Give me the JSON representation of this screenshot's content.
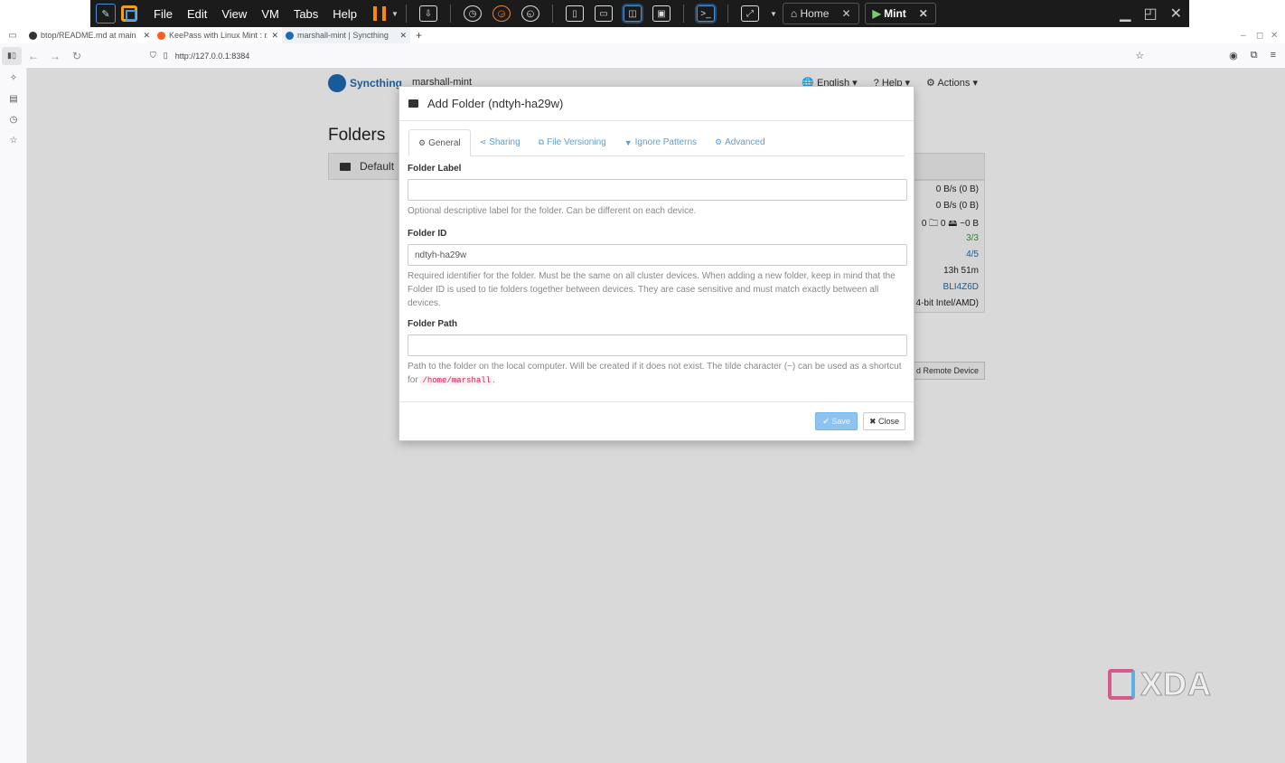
{
  "vm_toolbar": {
    "menu": [
      "File",
      "Edit",
      "View",
      "VM",
      "Tabs",
      "Help"
    ],
    "tabs": [
      {
        "label": "Home",
        "active": false
      },
      {
        "label": "Mint",
        "active": true
      }
    ]
  },
  "browser": {
    "tabs": [
      {
        "title": "btop/README.md at main",
        "active": false
      },
      {
        "title": "KeePass with Linux Mint : r/",
        "active": false
      },
      {
        "title": "marshall-mint | Syncthing",
        "active": true
      }
    ],
    "url": "http://127.0.0.1:8384"
  },
  "syncthing": {
    "brand": "Syncthing",
    "hostname": "marshall-mint",
    "nav": {
      "language": "English",
      "help": "Help",
      "actions": "Actions"
    },
    "folders_heading": "Folders",
    "default_folder": "Default",
    "device_stats": [
      {
        "text": "0 B/s (0 B)",
        "style": "normal"
      },
      {
        "text": "0 B/s (0 B)",
        "style": "normal"
      },
      {
        "text": "0   🗀 0   🖴 ~0 B",
        "style": "normal"
      },
      {
        "text": "3/3",
        "style": "green"
      },
      {
        "text": "4/5",
        "style": "blue"
      },
      {
        "text": "13h 51m",
        "style": "normal"
      },
      {
        "text": "BLI4Z6D",
        "style": "blue"
      },
      {
        "text": "4-bit Intel/AMD)",
        "style": "normal"
      }
    ],
    "add_remote_device": "d Remote Device"
  },
  "modal": {
    "title": "Add Folder (ndtyh-ha29w)",
    "tabs": [
      {
        "label": "General",
        "icon": "gear-icon",
        "glyph": "⚙",
        "active": true
      },
      {
        "label": "Sharing",
        "icon": "share-icon",
        "glyph": "⋖",
        "active": false
      },
      {
        "label": "File Versioning",
        "icon": "copy-icon",
        "glyph": "⧉",
        "active": false
      },
      {
        "label": "Ignore Patterns",
        "icon": "filter-icon",
        "glyph": "▼",
        "active": false
      },
      {
        "label": "Advanced",
        "icon": "cogs-icon",
        "glyph": "⚙",
        "active": false
      }
    ],
    "folder_label": {
      "label": "Folder Label",
      "value": "",
      "placeholder": "",
      "help": "Optional descriptive label for the folder. Can be different on each device."
    },
    "folder_id": {
      "label": "Folder ID",
      "value": "ndtyh-ha29w",
      "help": "Required identifier for the folder. Must be the same on all cluster devices. When adding a new folder, keep in mind that the Folder ID is used to tie folders together between devices. They are case sensitive and must match exactly between all devices."
    },
    "folder_path": {
      "label": "Folder Path",
      "value": "",
      "help_prefix": "Path to the folder on the local computer. Will be created if it does not exist. The tilde character (~) can be used as a shortcut for",
      "help_code": "/home/marshall",
      "help_suffix": "."
    },
    "save_label": "Save",
    "close_label": "Close"
  },
  "watermark": "XDA"
}
